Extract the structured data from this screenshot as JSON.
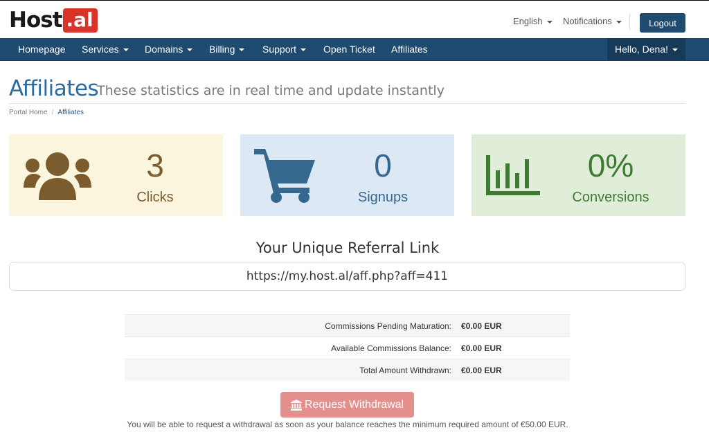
{
  "header": {
    "logo_host": "Host",
    "logo_al": ".al",
    "language": "English",
    "notifications": "Notifications",
    "logout": "Logout"
  },
  "nav": {
    "items": [
      {
        "label": "Homepage"
      },
      {
        "label": "Services"
      },
      {
        "label": "Domains"
      },
      {
        "label": "Billing"
      },
      {
        "label": "Support"
      },
      {
        "label": "Open Ticket"
      },
      {
        "label": "Affiliates"
      }
    ],
    "user": "Hello, Dena!"
  },
  "page": {
    "title": "Affiliates",
    "subtitle": "These statistics are in real time and update instantly",
    "breadcrumb": [
      "Portal Home",
      "Affiliates"
    ]
  },
  "stats": [
    {
      "value": "3",
      "label": "Clicks",
      "icon": "users-icon",
      "color": "#7a5c2e",
      "bg": "#faf5dc"
    },
    {
      "value": "0",
      "label": "Signups",
      "icon": "shopping-cart-icon",
      "color": "#35688f",
      "bg": "#dce9f5"
    },
    {
      "value": "0%",
      "label": "Conversions",
      "icon": "bar-chart-icon",
      "color": "#3f7a34",
      "bg": "#e0eed9"
    }
  ],
  "referral": {
    "title": "Your Unique Referral Link",
    "link": "https://my.host.al/aff.php?aff=411"
  },
  "commissions": [
    {
      "label": "Commissions Pending Maturation:",
      "value": "€0.00 EUR"
    },
    {
      "label": "Available Commissions Balance:",
      "value": "€0.00 EUR"
    },
    {
      "label": "Total Amount Withdrawn:",
      "value": "€0.00 EUR"
    }
  ],
  "withdraw": {
    "label": "Request Withdrawal",
    "icon": "bank-icon",
    "note": "You will be able to request a withdrawal as soon as your balance reaches the minimum required amount of €50.00 EUR."
  }
}
